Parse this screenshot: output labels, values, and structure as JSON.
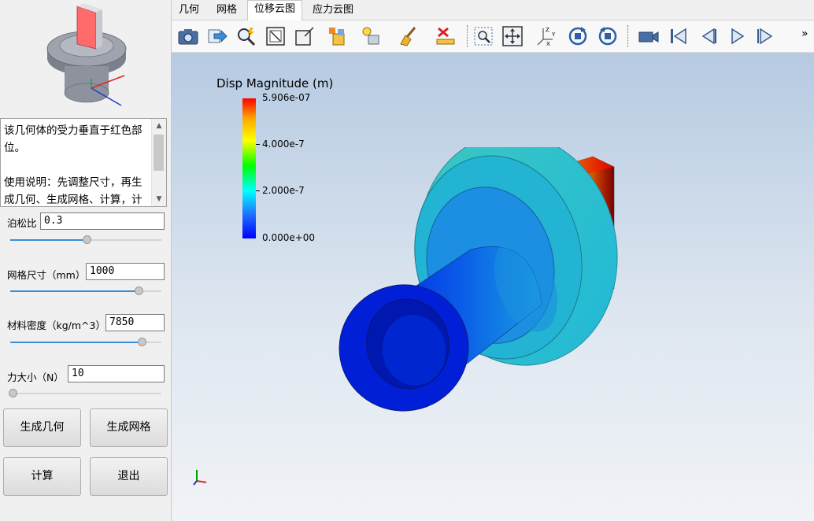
{
  "description": "该几何体的受力垂直于红色部位。\n\n使用说明：先调整尺寸，再生成几何、生成网格、计算，计算完成后可在右方查",
  "params": [
    {
      "label": "泊松比",
      "value": "0.3",
      "slider": 0.5
    },
    {
      "label": "网格尺寸（mm）",
      "value": "1000",
      "slider": 0.85
    },
    {
      "label": "材料密度（kg/m^3）",
      "value": "7850",
      "slider": 0.87
    },
    {
      "label": "力大小（N）",
      "value": "10",
      "slider": 0.0
    }
  ],
  "buttons": {
    "gen_geometry": "生成几何",
    "gen_mesh": "生成网格",
    "compute": "计算",
    "exit": "退出"
  },
  "tabs": [
    "几何",
    "网格",
    "位移云图",
    "应力云图"
  ],
  "active_tab": 2,
  "toolbar": {
    "overflow": "»"
  },
  "legend": {
    "title": "Disp Magnitude (m)",
    "labels": [
      "5.906e-07",
      "4.000e-7",
      "2.000e-7",
      "0.000e+00"
    ]
  },
  "colors": {
    "accent": "#3b8fd8",
    "target_face": "#ff6b6b"
  }
}
